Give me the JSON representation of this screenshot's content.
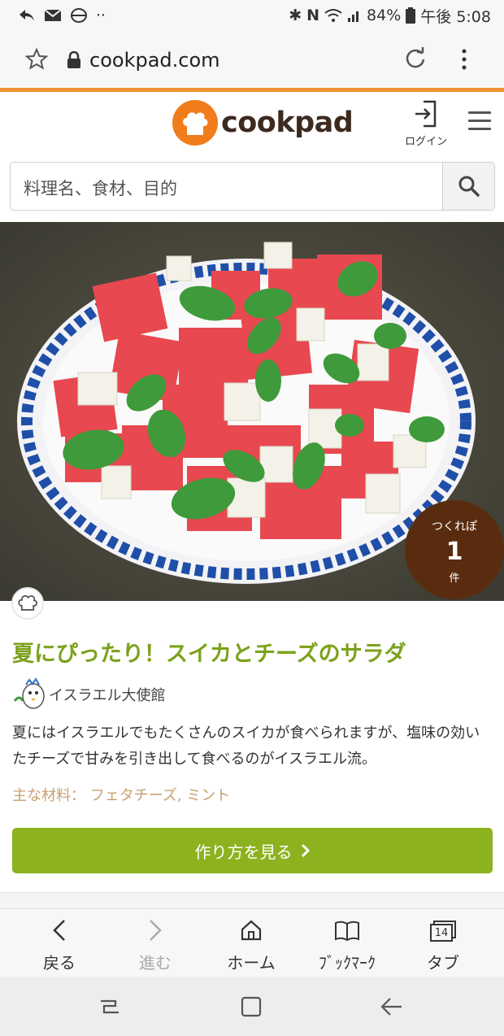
{
  "status_bar": {
    "battery": "84%",
    "time": "午後 5:08",
    "dots": "··"
  },
  "browser": {
    "url": "cookpad.com"
  },
  "site": {
    "logo_text": "cookpad",
    "login_label": "ログイン",
    "search_placeholder": "料理名、食材、目的"
  },
  "recipe": {
    "tsukurepo_label": "つくれぽ",
    "tsukurepo_count": "1",
    "tsukurepo_unit": "件",
    "title": "夏にぴったり！スイカとチーズのサラダ",
    "author": "イスラエル大使館",
    "description": "夏にはイスラエルでもたくさんのスイカが食べられますが、塩味の効いたチーズで甘みを引き出して食べるのがイスラエル流。",
    "ingredients_label": "主な材料：",
    "ingredients": "フェタチーズ, ミント",
    "cta_label": "作り方を見る"
  },
  "bottom_nav": {
    "back": "戻る",
    "forward": "進む",
    "home": "ホーム",
    "bookmarks": "ﾌﾞｯｸﾏｰｸ",
    "tabs": "タブ",
    "tab_count": "14"
  },
  "colors": {
    "accent_orange": "#f0922f",
    "title_green": "#7ba21b",
    "button_green": "#8cb21f",
    "badge_brown": "#5a2c0f"
  }
}
